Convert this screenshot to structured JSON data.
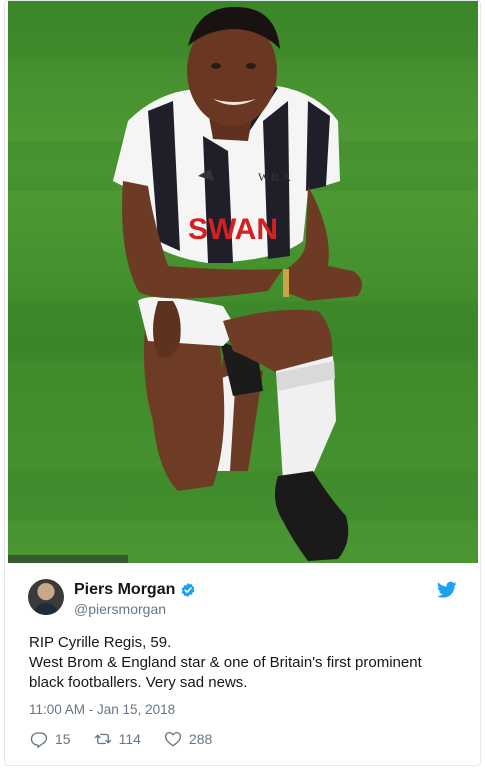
{
  "tweet": {
    "author": {
      "display_name": "Piers Morgan",
      "handle": "@piersmorgan",
      "verified": true
    },
    "text_lines": [
      "RIP Cyrille Regis, 59.",
      "West Brom & England star & one of Britain's first prominent",
      "black footballers. Very sad news."
    ],
    "timestamp": "11:00 AM - Jan 15, 2018",
    "actions": {
      "replies": "15",
      "retweets": "114",
      "likes": "288"
    },
    "colors": {
      "accent": "#1da1f2",
      "text": "#14171a",
      "muted": "#657786"
    }
  },
  "photo": {
    "shirt_text": "SWAN",
    "crest_text": "W.B.A"
  }
}
